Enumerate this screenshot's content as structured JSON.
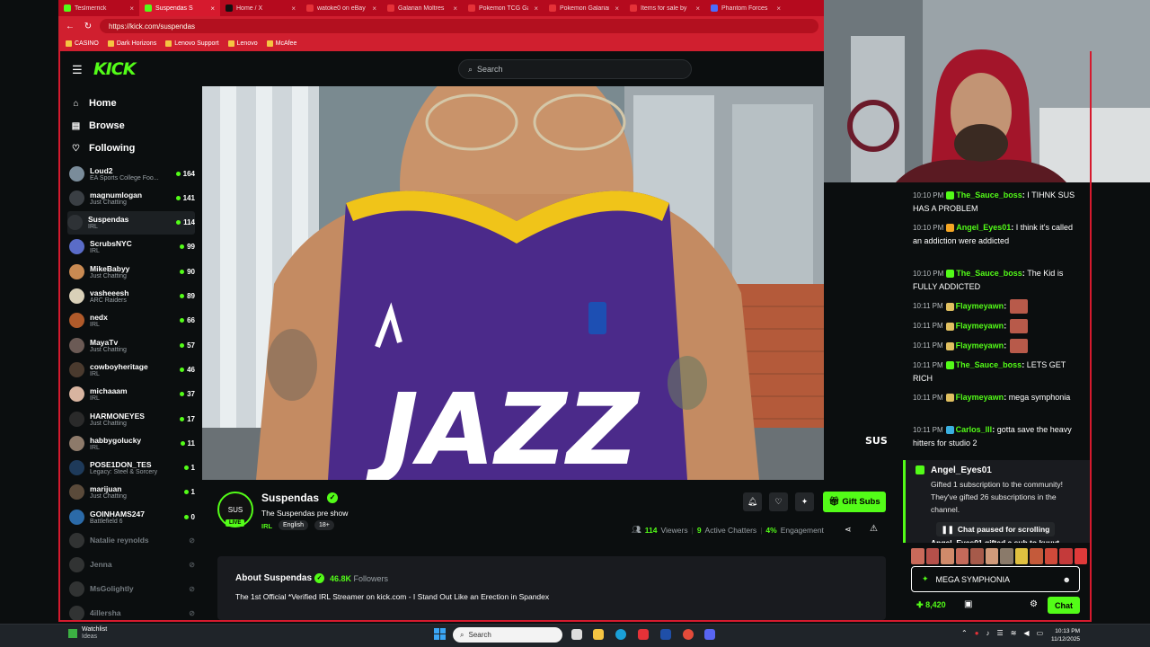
{
  "browser": {
    "tabs": [
      {
        "label": "Teslmerrick",
        "color": "#53fc18"
      },
      {
        "label": "Suspendas S",
        "color": "#53fc18",
        "active": true
      },
      {
        "label": "Home / X",
        "color": "#111111"
      },
      {
        "label": "watoke0 on eBay",
        "color": "#e53238"
      },
      {
        "label": "Galarian Moltres",
        "color": "#e53238"
      },
      {
        "label": "Pokemon TCG Gal",
        "color": "#e53238"
      },
      {
        "label": "Pokemon Galarian",
        "color": "#e53238"
      },
      {
        "label": "Items for sale by",
        "color": "#e53238"
      },
      {
        "label": "Phantom Forces",
        "color": "#4a6cff"
      }
    ],
    "url": "https://kick.com/suspendas",
    "bookmarks": [
      "CASINO",
      "Dark Horizons",
      "Lenovo Support",
      "Lenovo",
      "McAfee"
    ]
  },
  "kick": {
    "logo": "KICK",
    "search_placeholder": "Search"
  },
  "sidebar": {
    "nav": [
      {
        "label": "Home",
        "icon": "home-icon"
      },
      {
        "label": "Browse",
        "icon": "browse-icon"
      },
      {
        "label": "Following",
        "icon": "heart-icon"
      }
    ],
    "channels": [
      {
        "name": "Loud2",
        "category": "EA Sports College Foo...",
        "viewers": "164",
        "color": "#7a8c9a"
      },
      {
        "name": "magnumlogan",
        "category": "Just Chatting",
        "viewers": "141",
        "color": "#3a3f44"
      },
      {
        "name": "Suspendas",
        "category": "IRL",
        "viewers": "114",
        "color": "#2e3236",
        "selected": true
      },
      {
        "name": "ScrubsNYC",
        "category": "IRL",
        "viewers": "99",
        "color": "#5a6cc8"
      },
      {
        "name": "MikeBabyy",
        "category": "Just Chatting",
        "viewers": "90",
        "color": "#c98a52"
      },
      {
        "name": "vasheeesh",
        "category": "ARC Raiders",
        "viewers": "89",
        "color": "#d9d0b8"
      },
      {
        "name": "nedx",
        "category": "IRL",
        "viewers": "66",
        "color": "#b05a2a"
      },
      {
        "name": "MayaTv",
        "category": "Just Chatting",
        "viewers": "57",
        "color": "#6b5a55"
      },
      {
        "name": "cowboyheritage",
        "category": "IRL",
        "viewers": "46",
        "color": "#4a3a2e"
      },
      {
        "name": "michaaam",
        "category": "IRL",
        "viewers": "37",
        "color": "#d8b4a0"
      },
      {
        "name": "HARMONEYES",
        "category": "Just Chatting",
        "viewers": "17",
        "color": "#2a2a2a"
      },
      {
        "name": "habbygolucky",
        "category": "IRL",
        "viewers": "11",
        "color": "#8d7a6a"
      },
      {
        "name": "POSE1DON_TES",
        "category": "Legacy: Steel & Sorcery",
        "viewers": "1",
        "color": "#1e3a5a"
      },
      {
        "name": "marijuan",
        "category": "Just Chatting",
        "viewers": "1",
        "color": "#5a4a3a"
      },
      {
        "name": "GOINHAMS247",
        "category": "Battlefield 6",
        "viewers": "0",
        "color": "#2b6aa8"
      }
    ],
    "offline": [
      "Natalie reynolds",
      "Jenna",
      "MsGolightly",
      "4illersha"
    ]
  },
  "stream": {
    "streamer": "Suspendas",
    "avatar_text": "SUS",
    "live_label": "LIVE",
    "title": "The Suspendas pre show",
    "category": "IRL",
    "tags": [
      "English",
      "18+"
    ],
    "gift_subs_label": "Gift Subs",
    "viewers": "114",
    "viewers_label": "Viewers",
    "chatters": "9",
    "chatters_label": "Active Chatters",
    "engagement": "4%",
    "engagement_label": "Engagement",
    "overlay_tag": "SUS"
  },
  "about": {
    "title": "About Suspendas",
    "followers": "46.8K",
    "followers_label": "Followers",
    "bio": "The 1st Official *Verified IRL Streamer on kick.com - I Stand Out Like an Erection in Spandex"
  },
  "chat": {
    "messages": [
      {
        "time": "10:10 PM",
        "user": "The_Sauce_boss",
        "user_color": "#53fc18",
        "text": "I TIHNK SUS HAS A PROBLEM"
      },
      {
        "time": "10:10 PM",
        "user": "Angel_Eyes01",
        "user_color": "#53fc18",
        "text": "I think it's called an addiction were addicted"
      },
      {
        "time": "10:10 PM",
        "user": "The_Sauce_boss",
        "user_color": "#53fc18",
        "text": "The Kid is FULLY ADDICTED"
      },
      {
        "time": "10:11 PM",
        "user": "Flaymeyawn",
        "user_color": "#53fc18",
        "text": ""
      },
      {
        "time": "10:11 PM",
        "user": "Flaymeyawn",
        "user_color": "#53fc18",
        "text": ""
      },
      {
        "time": "10:11 PM",
        "user": "Flaymeyawn",
        "user_color": "#53fc18",
        "text": ""
      },
      {
        "time": "10:11 PM",
        "user": "The_Sauce_boss",
        "user_color": "#53fc18",
        "text": "LETS GET RICH"
      },
      {
        "time": "10:11 PM",
        "user": "Flaymeyawn",
        "user_color": "#53fc18",
        "text": "mega symphonia"
      },
      {
        "time": "10:11 PM",
        "user": "Carlos_lll",
        "user_color": "#53fc18",
        "text": "gotta save the heavy hitters for studio 2"
      }
    ],
    "gift": {
      "user": "Angel_Eyes01",
      "text": "Gifted 1 subscription to the community! They've gifted 26 subscriptions in the channel."
    },
    "paused_label": "Chat paused for scrolling",
    "behind_text": "Angel_Eyes01 gifted a sub to kuuyt",
    "input_value": "MEGA SYMPHONIA",
    "points": "8,420",
    "chat_button": "Chat"
  },
  "taskbar": {
    "widget_title": "Watchlist",
    "widget_sub": "Ideas",
    "search_label": "Search",
    "time": "10:13 PM",
    "date": "11/12/2025"
  },
  "colors": {
    "kick_green": "#53fc18",
    "browser_red": "#d01f2f",
    "bg": "#0b0e0f"
  }
}
